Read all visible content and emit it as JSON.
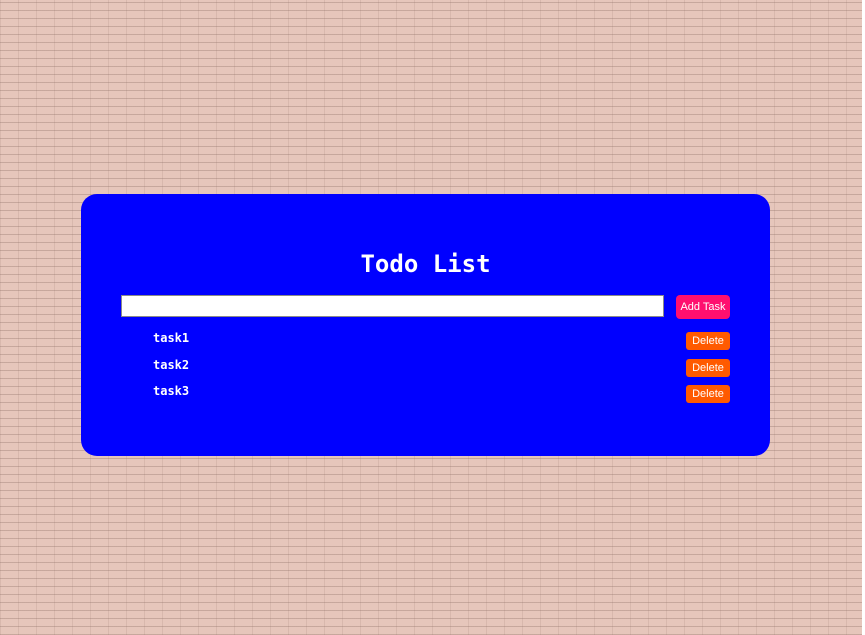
{
  "todo": {
    "title": "Todo List",
    "input": {
      "value": "",
      "placeholder": ""
    },
    "add_button_label": "Add Task",
    "tasks": [
      {
        "label": "task1",
        "delete_label": "Delete"
      },
      {
        "label": "task2",
        "delete_label": "Delete"
      },
      {
        "label": "task3",
        "delete_label": "Delete"
      }
    ]
  },
  "colors": {
    "card_background": "#0000ff",
    "add_button": "#ff0f6f",
    "delete_button": "#ff5a00",
    "page_background": "#e6c6bb",
    "text": "#ffffff"
  }
}
